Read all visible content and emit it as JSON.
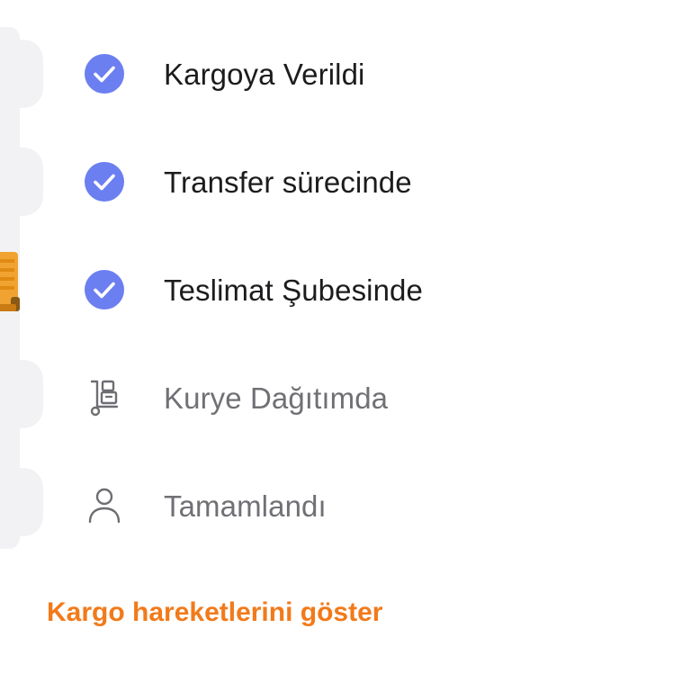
{
  "colors": {
    "accent_orange": "#f27a1a",
    "check_blue": "#6b7ff0",
    "done_text": "#1c1c1e",
    "pending_text": "#707075",
    "track_gray": "#f2f2f4"
  },
  "steps": [
    {
      "label": "Kargoya Verildi",
      "status": "done",
      "icon": "check-circle-icon"
    },
    {
      "label": "Transfer sürecinde",
      "status": "done",
      "icon": "check-circle-icon"
    },
    {
      "label": "Teslimat Şubesinde",
      "status": "done",
      "icon": "check-circle-icon"
    },
    {
      "label": "Kurye Dağıtımda",
      "status": "pending",
      "icon": "courier-trolley-icon"
    },
    {
      "label": "Tamamlandı",
      "status": "pending",
      "icon": "person-icon"
    }
  ],
  "actions": {
    "show_movements_label": "Kargo hareketlerini göster"
  }
}
